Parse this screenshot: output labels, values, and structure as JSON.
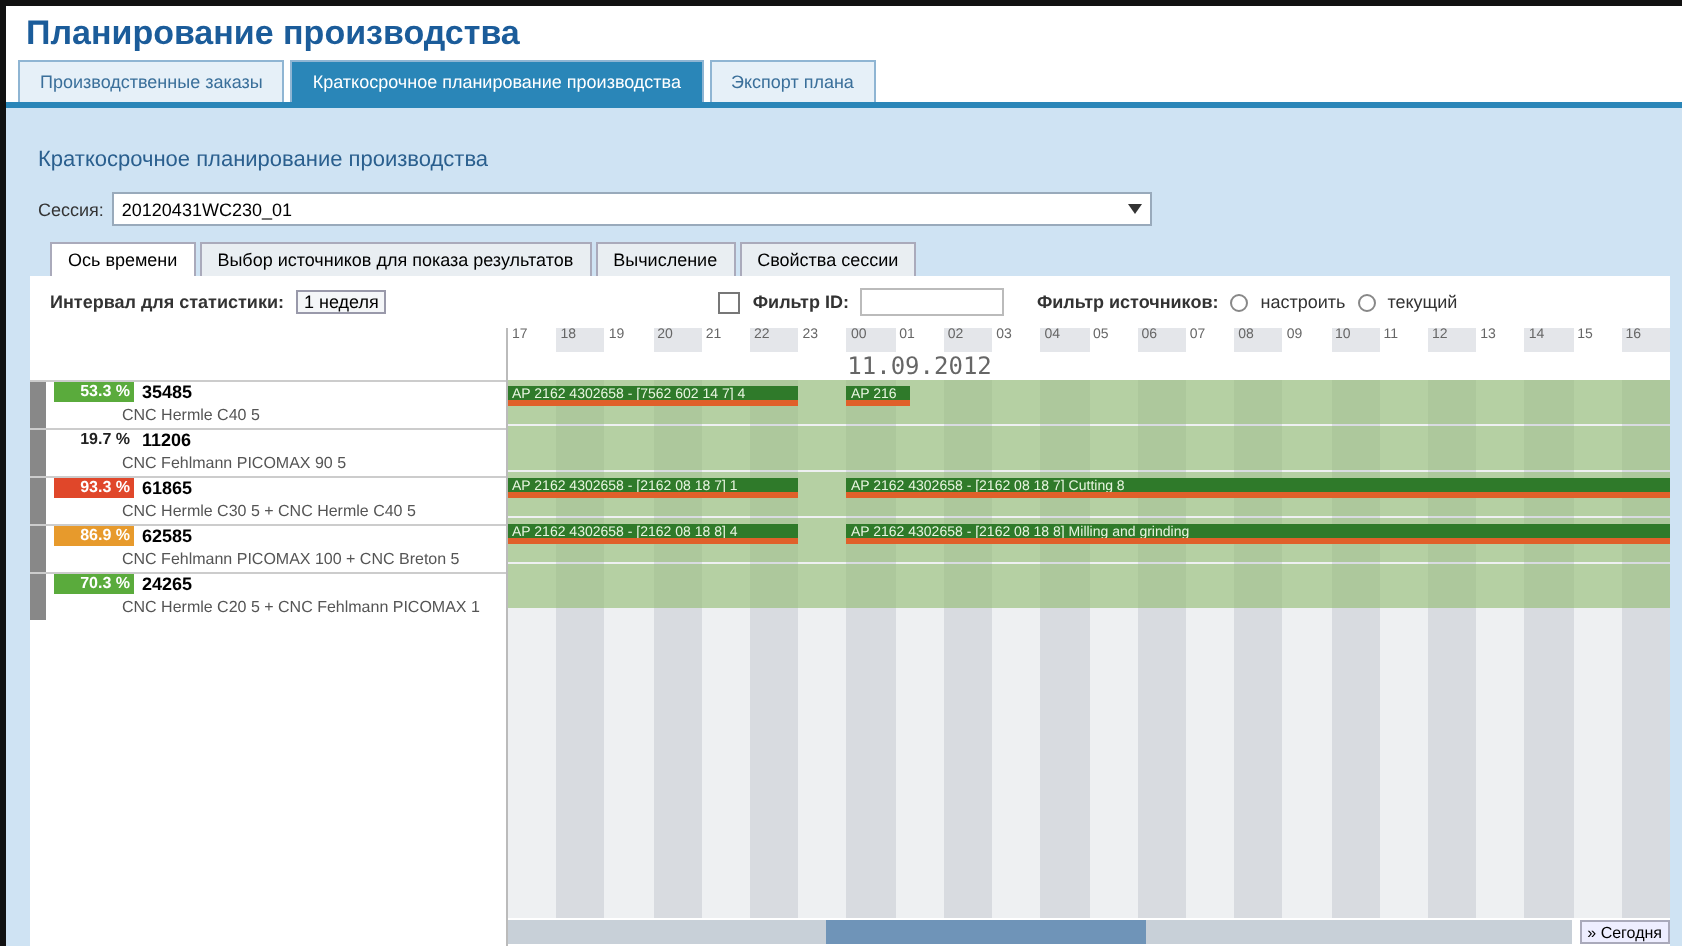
{
  "title": "Планирование производства",
  "tabs": [
    {
      "label": "Производственные заказы",
      "selected": false
    },
    {
      "label": "Краткосрочное планирование производства",
      "selected": true
    },
    {
      "label": "Экспорт плана",
      "selected": false
    }
  ],
  "heading": "Краткосрочное планирование производства",
  "session": {
    "label": "Сессия:",
    "value": "20120431WC230_01"
  },
  "subtabs": [
    {
      "label": "Ось времени",
      "selected": true
    },
    {
      "label": "Выбор источников для показа результатов",
      "selected": false
    },
    {
      "label": "Вычисление",
      "selected": false
    },
    {
      "label": "Свойства сессии",
      "selected": false
    }
  ],
  "interval": {
    "label": "Интервал для статистики:",
    "value": "1 неделя"
  },
  "id_filter": {
    "checked": false,
    "label": "Фильтр ID:"
  },
  "source_filter": {
    "label": "Фильтр источников:",
    "options": [
      {
        "label": "настроить",
        "selected": false
      },
      {
        "label": "текущий",
        "selected": false
      }
    ]
  },
  "hours": [
    "17",
    "18",
    "19",
    "20",
    "21",
    "22",
    "23",
    "00",
    "01",
    "02",
    "03",
    "04",
    "05",
    "06",
    "07",
    "08",
    "09",
    "10",
    "11",
    "12",
    "13",
    "14",
    "15",
    "16"
  ],
  "date": "11.09.2012",
  "rows": [
    {
      "badge": "53.3 %",
      "color": "#5aab3c",
      "id": "35485",
      "resource": "CNC Hermle C40 5",
      "bars": [
        {
          "kind": "full",
          "label": "AP 2162 4302658 - [7562 602 14 7] 4"
        },
        {
          "kind": "short",
          "label": "AP 216"
        }
      ]
    },
    {
      "badge": "19.7 %",
      "color": "#ffffff",
      "id": "11206",
      "resource": "CNC Fehlmann PICOMAX 90 5",
      "bars": []
    },
    {
      "badge": "93.3 %",
      "color": "#e0472a",
      "id": "61865",
      "resource": "CNC Hermle C30 5 + CNC Hermle C40 5",
      "bars": [
        {
          "kind": "full",
          "label": "AP 2162 4302658 - [2162 08 18 7] 1"
        },
        {
          "kind": "full",
          "label": "AP 2162 4302658 - [2162 08 18 7] Cutting 8"
        }
      ]
    },
    {
      "badge": "86.9 %",
      "color": "#e79a2c",
      "id": "62585",
      "resource": "CNC Fehlmann PICOMAX 100 + CNC Breton 5",
      "bars": [
        {
          "kind": "full",
          "label": "AP 2162 4302658 - [2162 08 18 8] 4"
        },
        {
          "kind": "full",
          "label": "AP 2162 4302658 - [2162 08 18 8] Milling and grinding"
        }
      ]
    },
    {
      "badge": "70.3 %",
      "color": "#5aab3c",
      "id": "24265",
      "resource": "CNC Hermle C20 5 + CNC Fehlmann PICOMAX 1",
      "bars": []
    }
  ],
  "today_button": "» Сегодня"
}
